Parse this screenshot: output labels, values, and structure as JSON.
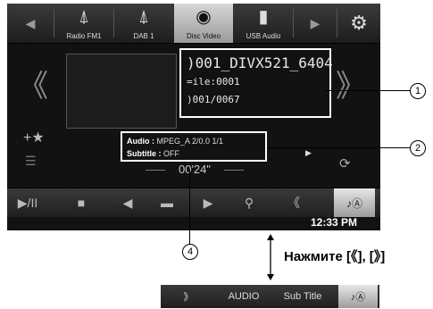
{
  "topbar": {
    "items": [
      {
        "label": "Radio FM1",
        "icon": "antenna-icon"
      },
      {
        "label": "DAB 1",
        "icon": "dab-antenna-icon"
      },
      {
        "label": "Disc Video",
        "icon": "disc-icon"
      },
      {
        "label": "USB Audio",
        "icon": "usb-icon"
      }
    ]
  },
  "info": {
    "title": ")001_DIVX521_6404",
    "file": "=ile:0001",
    "track": ")001/0067"
  },
  "audio": {
    "audio_label": "Audio :",
    "audio_value": "MPEG_A  2/0.0  1/1",
    "subtitle_label": "Subtitle :",
    "subtitle_value": "OFF"
  },
  "time": "00'24\"",
  "clock": "12:33 PM",
  "callouts": {
    "c1": "1",
    "c2": "2",
    "c4": "4"
  },
  "press_text": "Нажмите [《], [》]",
  "strip": {
    "audio": "AUDIO",
    "subtitle": "Sub Title"
  }
}
